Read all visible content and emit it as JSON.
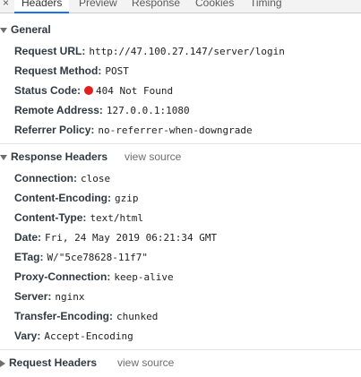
{
  "tabs": [
    {
      "label": "Headers",
      "active": true
    },
    {
      "label": "Preview",
      "active": false
    },
    {
      "label": "Response",
      "active": false
    },
    {
      "label": "Cookies",
      "active": false
    },
    {
      "label": "Timing",
      "active": false
    }
  ],
  "general": {
    "title": "General",
    "rows": [
      {
        "name": "Request URL:",
        "value": "http://47.100.27.147/server/login"
      },
      {
        "name": "Request Method:",
        "value": "POST"
      },
      {
        "name": "Status Code:",
        "value": "404 Not Found",
        "status_color": "#e0201d"
      },
      {
        "name": "Remote Address:",
        "value": "127.0.0.1:1080"
      },
      {
        "name": "Referrer Policy:",
        "value": "no-referrer-when-downgrade"
      }
    ]
  },
  "response_headers": {
    "title": "Response Headers",
    "view_source": "view source",
    "rows": [
      {
        "name": "Connection:",
        "value": "close"
      },
      {
        "name": "Content-Encoding:",
        "value": "gzip"
      },
      {
        "name": "Content-Type:",
        "value": "text/html"
      },
      {
        "name": "Date:",
        "value": "Fri, 24 May 2019 06:21:34 GMT"
      },
      {
        "name": "ETag:",
        "value": "W/\"5ce78628-11f7\""
      },
      {
        "name": "Proxy-Connection:",
        "value": "keep-alive"
      },
      {
        "name": "Server:",
        "value": "nginx"
      },
      {
        "name": "Transfer-Encoding:",
        "value": "chunked"
      },
      {
        "name": "Vary:",
        "value": "Accept-Encoding"
      }
    ]
  },
  "request_headers": {
    "title": "Request Headers",
    "view_source": "view source"
  },
  "close_icon": "×"
}
